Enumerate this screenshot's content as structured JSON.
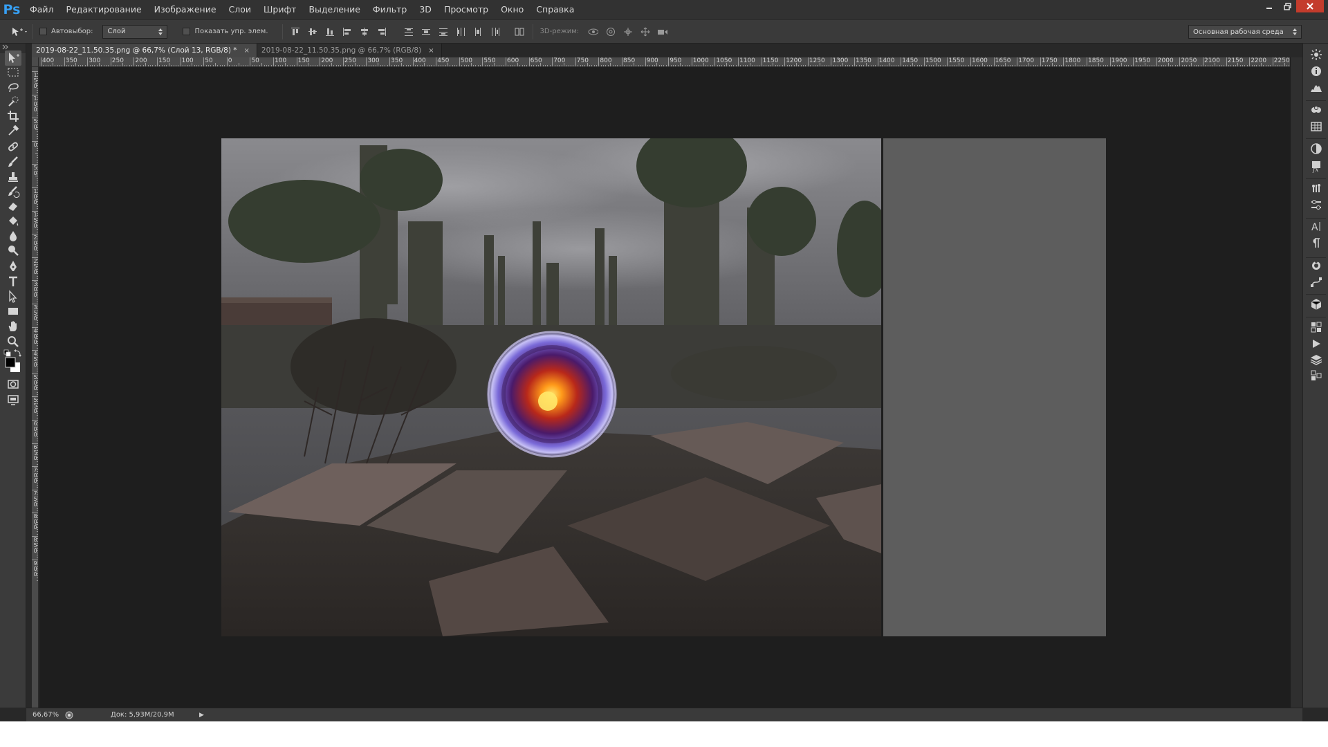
{
  "app": {
    "logo": "Ps",
    "menu": [
      "Файл",
      "Редактирование",
      "Изображение",
      "Слои",
      "Шрифт",
      "Выделение",
      "Фильтр",
      "3D",
      "Просмотр",
      "Окно",
      "Справка"
    ]
  },
  "options": {
    "autoselect_label": "Автовыбор:",
    "autoselect_value": "Слой",
    "show_transform_label": "Показать упр. элем.",
    "mode_3d_label": "3D-режим:",
    "workspace_value": "Основная рабочая среда"
  },
  "tabs": [
    {
      "title": "2019-08-22_11.50.35.png @ 66,7% (Слой 13, RGB/8) *",
      "close": "×",
      "active": true
    },
    {
      "title": "2019-08-22_11.50.35.png @ 66,7% (RGB/8)",
      "close": "×",
      "active": false
    }
  ],
  "ruler": {
    "top_labels": [
      "400",
      "350",
      "300",
      "250",
      "200",
      "150",
      "100",
      "50",
      "0",
      "50",
      "100",
      "150",
      "200",
      "250",
      "300",
      "350",
      "400",
      "450",
      "500",
      "550",
      "600",
      "650",
      "700",
      "750",
      "800",
      "850",
      "900",
      "950",
      "1000",
      "1050",
      "1100",
      "1150",
      "1200",
      "1250",
      "1300",
      "1350",
      "1400",
      "1450",
      "1500",
      "1550",
      "1600",
      "1650",
      "1700",
      "1750",
      "1800",
      "1850",
      "1900",
      "1950",
      "2000",
      "2050",
      "2100",
      "2150",
      "2200",
      "2250",
      "2"
    ],
    "left_labels": [
      "150",
      "100",
      "50",
      "0",
      "50",
      "100",
      "150",
      "200",
      "250",
      "300",
      "350",
      "400",
      "450",
      "500",
      "550",
      "600",
      "650",
      "700",
      "750",
      "800",
      "850",
      "900"
    ]
  },
  "status": {
    "zoom": "66,67%",
    "doc_info": "Док: 5,93M/20,9M",
    "arrow": "▶"
  },
  "colors": {
    "menubar": "#323232",
    "workspace": "#1e1e1e",
    "accent": "#37a0f4",
    "close_button": "#c43c2c"
  },
  "tools": [
    "move-tool",
    "marquee-tool",
    "lasso-tool",
    "quick-selection-tool",
    "crop-tool",
    "eyedropper-tool",
    "healing-brush-tool",
    "brush-tool",
    "clone-stamp-tool",
    "history-brush-tool",
    "eraser-tool",
    "paint-bucket-tool",
    "blur-tool",
    "dodge-tool",
    "pen-tool",
    "type-tool",
    "path-selection-tool",
    "rectangle-tool",
    "hand-tool",
    "zoom-tool"
  ],
  "right_panel_icons": [
    "color-icon",
    "info-icon",
    "histogram-icon",
    "styles-icon",
    "swatches-icon",
    "adjustments-icon",
    "layer-styles-icon",
    "brush-presets-icon",
    "clone-source-icon",
    "character-icon",
    "paragraph-icon",
    "3d-icon",
    "paths-icon",
    "3d-cube-icon",
    "layer-comps-icon",
    "actions-icon",
    "layers-icon",
    "channels-icon"
  ]
}
